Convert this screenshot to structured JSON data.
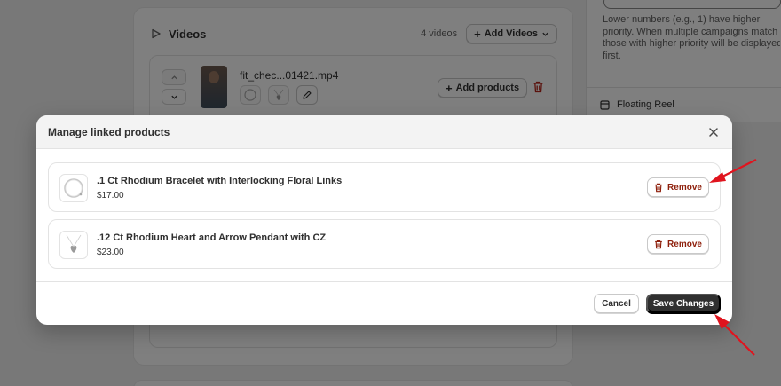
{
  "background": {
    "videos_title": "Videos",
    "video_count": "4 videos",
    "add_videos_label": "Add Videos",
    "video_filename": "fit_chec...01421.mp4",
    "add_products_label": "Add products",
    "priority_help": [
      "Lower numbers (e.g., 1) have higher",
      "priority. When multiple campaigns match",
      "those with higher priority will be displayed",
      "first."
    ],
    "floating_reel_label": "Floating Reel"
  },
  "modal": {
    "title": "Manage linked products",
    "products": [
      {
        "name": ".1 Ct Rhodium Bracelet with Interlocking Floral Links",
        "price": "$17.00",
        "image_icon": "bracelet-icon"
      },
      {
        "name": ".12 Ct Rhodium Heart and Arrow Pendant with CZ",
        "price": "$23.00",
        "image_icon": "pendant-icon"
      }
    ],
    "remove_label": "Remove",
    "cancel_label": "Cancel",
    "save_label": "Save Changes"
  },
  "colors": {
    "primary_button": "#303030",
    "remove_text": "#8e1f0b",
    "annotation_arrow": "#e0141e",
    "overlay": "rgba(0,0,0,0.5)"
  }
}
